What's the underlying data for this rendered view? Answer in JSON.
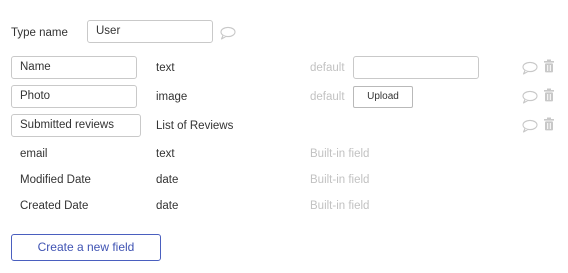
{
  "header": {
    "type_name_label": "Type name",
    "type_name_value": "User"
  },
  "fields": [
    {
      "name": "Name",
      "type": "text",
      "default_label": "default",
      "default_value": "",
      "editable": true,
      "control": "input"
    },
    {
      "name": "Photo",
      "type": "image",
      "default_label": "default",
      "upload_label": "Upload",
      "editable": true,
      "control": "upload"
    },
    {
      "name": "Submitted reviews",
      "type": "List of Reviews",
      "editable": true,
      "control": "none"
    },
    {
      "name": "email",
      "type": "text",
      "note": "Built-in field",
      "editable": false
    },
    {
      "name": "Modified Date",
      "type": "date",
      "note": "Built-in field",
      "editable": false
    },
    {
      "name": "Created Date",
      "type": "date",
      "note": "Built-in field",
      "editable": false
    }
  ],
  "actions": {
    "create_field_label": "Create a new field"
  },
  "icons": {
    "comment": "comment-icon",
    "delete": "trash-icon"
  },
  "colors": {
    "accent": "#3f53b3",
    "muted_text": "#c2c2c2",
    "icon": "#c8c8c8",
    "border": "#c9c9c9"
  }
}
